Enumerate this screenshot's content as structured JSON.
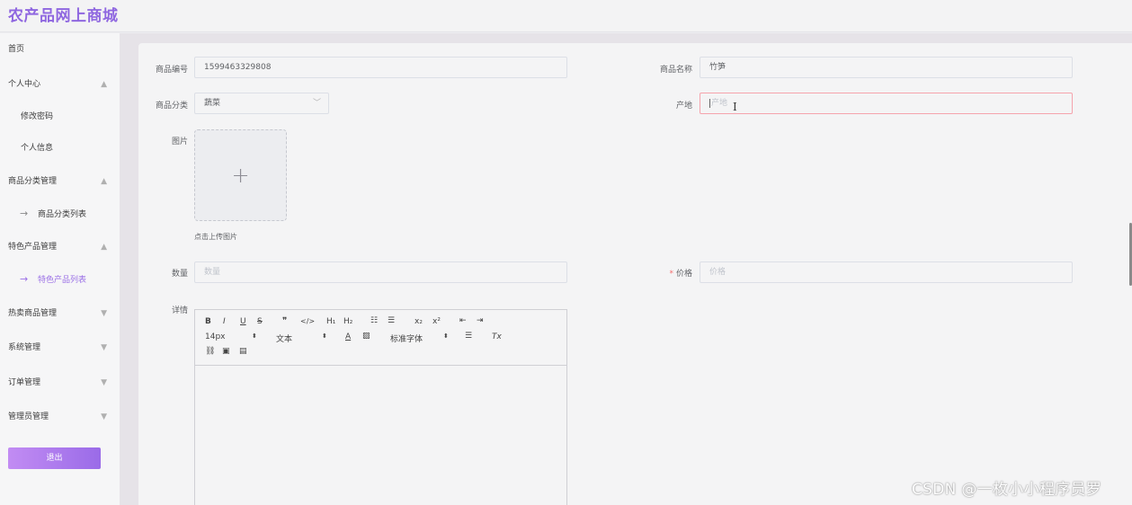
{
  "app": {
    "title": "农产品网上商城"
  },
  "sidebar": {
    "items": [
      {
        "label": "首页"
      },
      {
        "label": "个人中心",
        "expanded": true,
        "chevron": "▲"
      },
      {
        "label": "修改密码"
      },
      {
        "label": "个人信息"
      },
      {
        "label": "商品分类管理",
        "expanded": true,
        "chevron": "▲"
      },
      {
        "label": "商品分类列表",
        "icon": "arrow-right-icon"
      },
      {
        "label": "特色产品管理",
        "expanded": true,
        "chevron": "▲"
      },
      {
        "label": "特色产品列表",
        "icon": "arrow-right-icon",
        "active": true
      },
      {
        "label": "热卖商品管理",
        "expanded": false,
        "chevron": "▼"
      },
      {
        "label": "系统管理",
        "expanded": false,
        "chevron": "▼"
      },
      {
        "label": "订单管理",
        "expanded": false,
        "chevron": "▼"
      },
      {
        "label": "管理员管理",
        "expanded": false,
        "chevron": "▼"
      }
    ],
    "logout_label": "退出"
  },
  "form": {
    "code": {
      "label": "商品编号",
      "value": "1599463329808"
    },
    "name": {
      "label": "商品名称",
      "value": "竹笋"
    },
    "category": {
      "label": "商品分类",
      "value": "蔬菜"
    },
    "origin": {
      "label": "产地",
      "placeholder": "产地",
      "value": ""
    },
    "image": {
      "label": "图片",
      "tip": "点击上传图片"
    },
    "quantity": {
      "label": "数量",
      "placeholder": "数量"
    },
    "price": {
      "label": "价格",
      "placeholder": "价格",
      "required_mark": "*"
    },
    "details": {
      "label": "详情",
      "toolbar": {
        "bold": "B",
        "italic": "I",
        "underline": "U",
        "strike": "S",
        "quote": "❞",
        "code": "</>",
        "h1": "H₁",
        "h2": "H₂",
        "ordered_list": "☷",
        "bullet_list": "☰",
        "sub": "x₂",
        "sup": "x²",
        "outdent": "⇤",
        "indent": "⇥",
        "size": "14px",
        "type": "文本",
        "font": "标准字体",
        "updown": "⬍",
        "color": "A",
        "background": "▨",
        "align": "☰",
        "clean": "Tx",
        "link": "⛓",
        "image": "▣",
        "video": "▤"
      }
    }
  },
  "watermark": "CSDN @一枚小小程序员罗",
  "colors": {
    "brand": "#8f67e0",
    "active": "#9a6fe6",
    "error_border": "#f5a3ac",
    "logout_gradient_start": "#c28cf3",
    "logout_gradient_end": "#9a6be8"
  }
}
